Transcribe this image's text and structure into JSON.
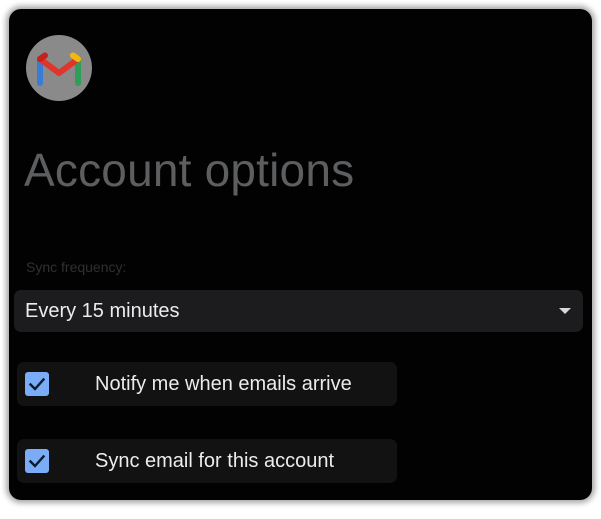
{
  "app": {
    "logo_icon": "gmail-logo-icon"
  },
  "header": {
    "title": "Account options"
  },
  "sync": {
    "label": "Sync frequency:",
    "selected": "Every 15 minutes"
  },
  "options": [
    {
      "label": "Notify me when emails arrive",
      "checked": true
    },
    {
      "label": "Sync email for this account",
      "checked": true
    }
  ],
  "colors": {
    "background": "#020202",
    "checkbox_accent": "#7bacf7",
    "title_text": "#5d5e60",
    "field_background": "#1c1c1e"
  }
}
